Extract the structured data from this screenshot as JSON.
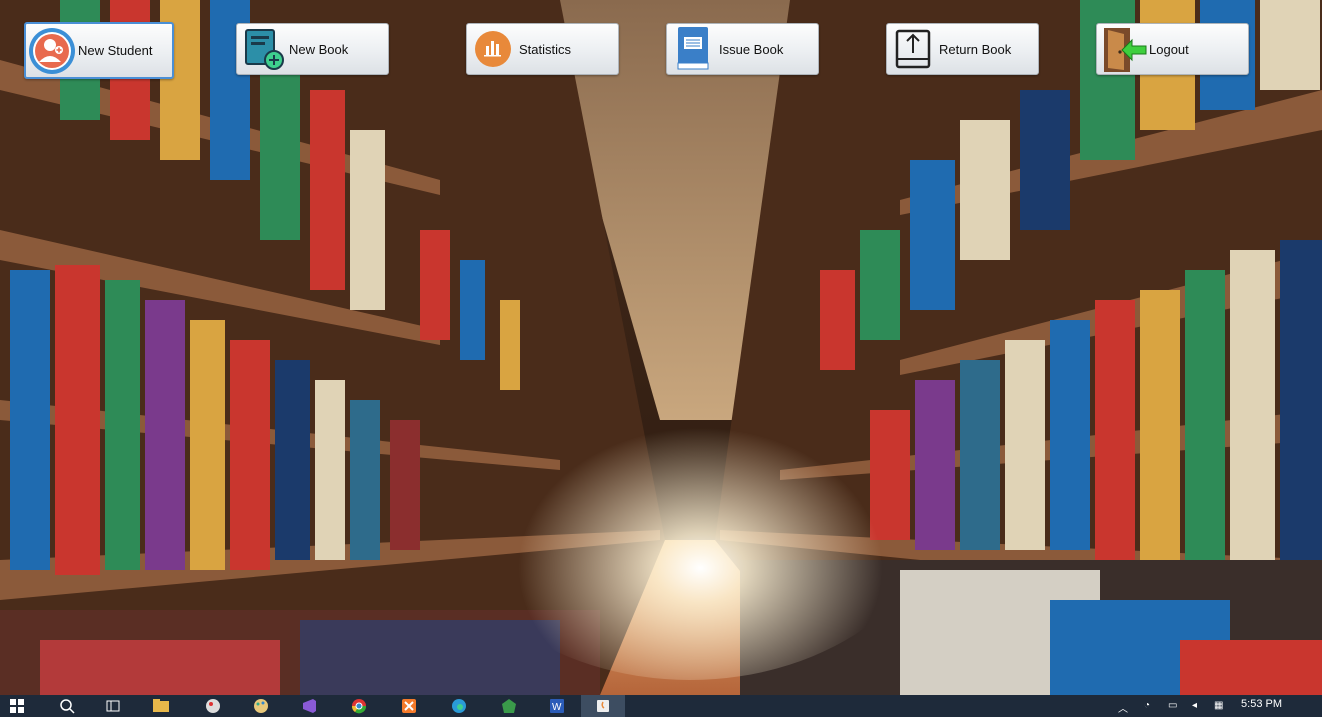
{
  "toolbar": {
    "new_student": "New Student",
    "new_book": "New Book",
    "statistics": "Statistics",
    "issue_book": "Issue Book",
    "return_book": "Return Book",
    "logout": "Logout"
  },
  "taskbar": {
    "clock": "5:53 PM",
    "apps": [
      "windows-start",
      "search",
      "task-view",
      "file-explorer",
      "paint",
      "paint-palette",
      "visual-studio",
      "chrome",
      "xampp",
      "edge",
      "app-green",
      "word",
      "java"
    ]
  },
  "colors": {
    "accent_blue": "#4a8fd6",
    "taskbar_bg": "#1e2a3a",
    "button_bg": "#eceff2"
  }
}
